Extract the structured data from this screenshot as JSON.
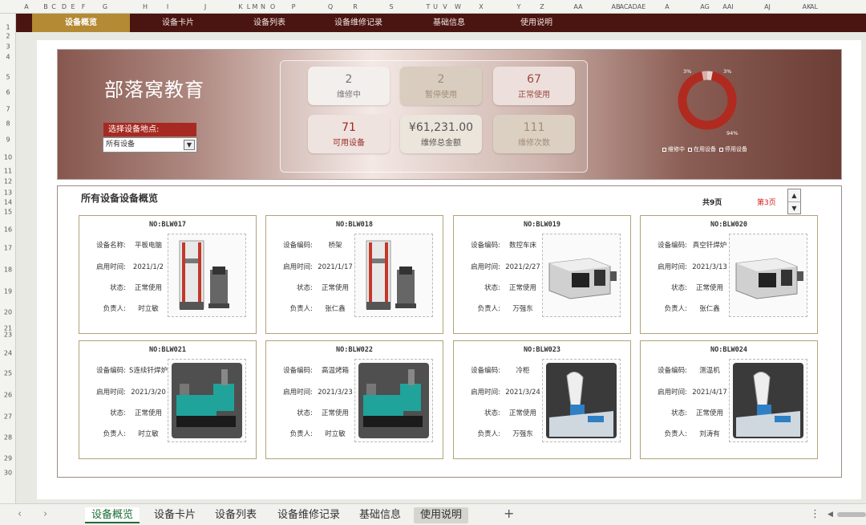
{
  "colors": {
    "accent": "#4a1410",
    "gold": "#b48a34",
    "card_border": "#b4a17a",
    "alert": "#d0201a"
  },
  "col_headers": [
    "A",
    "B",
    "C",
    "D",
    "E",
    "F",
    "G",
    "H",
    "I",
    "J",
    "K",
    "L",
    "M",
    "N",
    "O",
    "P",
    "Q",
    "R",
    "S",
    "T",
    "U",
    "V",
    "W",
    "X",
    "Y",
    "Z",
    "AA",
    "AB",
    "AC",
    "AD",
    "AE",
    "A",
    "AG",
    "AAI",
    "AJ",
    "AK",
    "AL"
  ],
  "row_headers": [
    "1",
    "2",
    "3",
    "4",
    "5",
    "6",
    "7",
    "8",
    "9",
    "10",
    "11",
    "12",
    "13",
    "14",
    "15",
    "16",
    "17",
    "18",
    "19",
    "20",
    "21",
    "23",
    "24",
    "25",
    "26",
    "27",
    "28",
    "29",
    "30"
  ],
  "nav": {
    "tabs": [
      "设备概览",
      "设备卡片",
      "设备列表",
      "设备维修记录",
      "基础信息",
      "使用说明"
    ]
  },
  "brand": "部落窝教育",
  "location": {
    "label": "选择设备地点:",
    "value": "所有设备"
  },
  "kpis": [
    {
      "value": "2",
      "label": "维修中",
      "bg": "#f3efed",
      "color": "#777"
    },
    {
      "value": "2",
      "label": "暂停使用",
      "bg": "#d9cdc0",
      "color": "#a08c76"
    },
    {
      "value": "67",
      "label": "正常使用",
      "bg": "#ede0dc",
      "color": "#9a4a3f"
    },
    {
      "value": "71",
      "label": "可用设备",
      "bg": "#efe3e0",
      "color": "#9a2a22"
    },
    {
      "value": "¥61,231.00",
      "label": "维修总金额",
      "bg": "#ece5dc",
      "color": "#555"
    },
    {
      "value": "111",
      "label": "维修次数",
      "bg": "#dcd0c2",
      "color": "#a08c76"
    }
  ],
  "donut": {
    "segments": [
      {
        "name": "维修中",
        "pct": 3,
        "color": "#e6d3cf"
      },
      {
        "name": "在用设备",
        "pct": 94,
        "color": "#b02a20"
      },
      {
        "name": "停用设备",
        "pct": 3,
        "color": "#d9b0a8"
      }
    ],
    "labels": [
      "3%",
      "3%",
      "94%"
    ]
  },
  "overview": {
    "title": "所有设备设备概览",
    "total_pages": "共9页",
    "current_page": "第3页",
    "spin_up": "▲",
    "spin_down": "▼"
  },
  "cards": [
    {
      "no": "NO:BLW017",
      "k1": "设备名称:",
      "name": "平板电脑",
      "date": "2021/1/2",
      "status": "正常使用",
      "owner": "时立敏",
      "img": "tensile"
    },
    {
      "no": "NO:BLW018",
      "k1": "设备编码:",
      "name": "桥架",
      "date": "2021/1/17",
      "status": "正常使用",
      "owner": "张仁鑫",
      "img": "tensile"
    },
    {
      "no": "NO:BLW019",
      "k1": "设备编码:",
      "name": "数控车床",
      "date": "2021/2/27",
      "status": "正常使用",
      "owner": "万强东",
      "img": "lathe"
    },
    {
      "no": "NO:BLW020",
      "k1": "设备编码:",
      "name": "真空钎焊炉",
      "date": "2021/3/13",
      "status": "正常使用",
      "owner": "张仁鑫",
      "img": "lathe"
    },
    {
      "no": "NO:BLW021",
      "k1": "设备编码:",
      "name": "S连续钎焊炉",
      "date": "2021/3/20",
      "status": "正常使用",
      "owner": "时立敏",
      "img": "molding"
    },
    {
      "no": "NO:BLW022",
      "k1": "设备编码:",
      "name": "高温烤箱",
      "date": "2021/3/23",
      "status": "正常使用",
      "owner": "时立敏",
      "img": "molding"
    },
    {
      "no": "NO:BLW023",
      "k1": "设备编码:",
      "name": "冷柜",
      "date": "2021/3/24",
      "status": "正常使用",
      "owner": "万强东",
      "img": "waterjet"
    },
    {
      "no": "NO:BLW024",
      "k1": "设备编码:",
      "name": "测温机",
      "date": "2021/4/17",
      "status": "正常使用",
      "owner": "刘涛有",
      "img": "waterjet"
    }
  ],
  "card_keys": {
    "date": "启用时间:",
    "status": "状态:",
    "owner": "负责人:"
  },
  "sheet_tabs": [
    "设备概览",
    "设备卡片",
    "设备列表",
    "设备维修记录",
    "基础信息",
    "使用说明"
  ],
  "icons": {
    "prev": "‹",
    "next": "›",
    "add": "+",
    "more": "⋮",
    "scroll_left": "◀"
  }
}
